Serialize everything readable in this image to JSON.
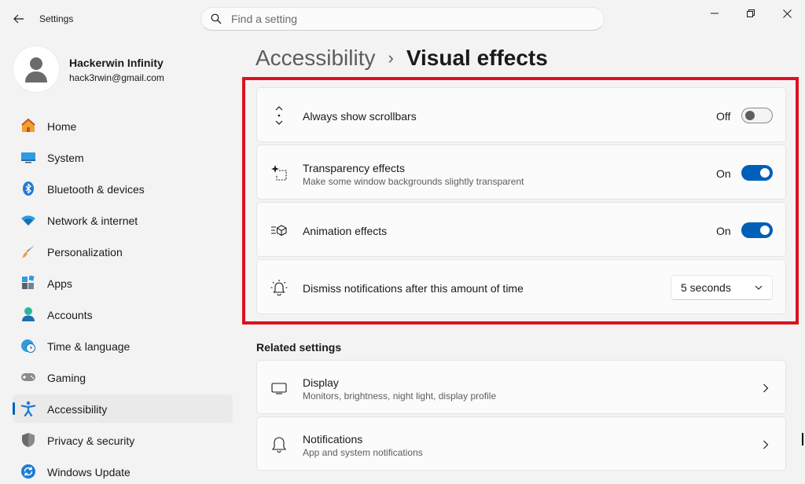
{
  "window": {
    "title": "Settings",
    "search_placeholder": "Find a setting"
  },
  "profile": {
    "name": "Hackerwin Infinity",
    "email": "hack3rwin@gmail.com"
  },
  "nav": {
    "items": [
      {
        "label": "Home",
        "icon": "home-icon"
      },
      {
        "label": "System",
        "icon": "system-icon"
      },
      {
        "label": "Bluetooth & devices",
        "icon": "bluetooth-icon"
      },
      {
        "label": "Network & internet",
        "icon": "wifi-icon"
      },
      {
        "label": "Personalization",
        "icon": "brush-icon"
      },
      {
        "label": "Apps",
        "icon": "apps-icon"
      },
      {
        "label": "Accounts",
        "icon": "accounts-icon"
      },
      {
        "label": "Time & language",
        "icon": "globe-clock-icon"
      },
      {
        "label": "Gaming",
        "icon": "gamepad-icon"
      },
      {
        "label": "Accessibility",
        "icon": "accessibility-icon",
        "selected": true
      },
      {
        "label": "Privacy & security",
        "icon": "shield-icon"
      },
      {
        "label": "Windows Update",
        "icon": "update-icon"
      }
    ]
  },
  "breadcrumb": {
    "parent": "Accessibility",
    "separator": "›",
    "current": "Visual effects"
  },
  "settings": {
    "scrollbars": {
      "title": "Always show scrollbars",
      "state": "Off",
      "on": false
    },
    "transparency": {
      "title": "Transparency effects",
      "subtitle": "Make some window backgrounds slightly transparent",
      "state": "On",
      "on": true
    },
    "animation": {
      "title": "Animation effects",
      "state": "On",
      "on": true
    },
    "notifications": {
      "title": "Dismiss notifications after this amount of time",
      "value": "5 seconds"
    }
  },
  "related": {
    "title": "Related settings",
    "display": {
      "title": "Display",
      "subtitle": "Monitors, brightness, night light, display profile"
    },
    "notifications": {
      "title": "Notifications",
      "subtitle": "App and system notifications"
    }
  },
  "colors": {
    "accent": "#005fb8",
    "highlight": "#e0101d"
  }
}
